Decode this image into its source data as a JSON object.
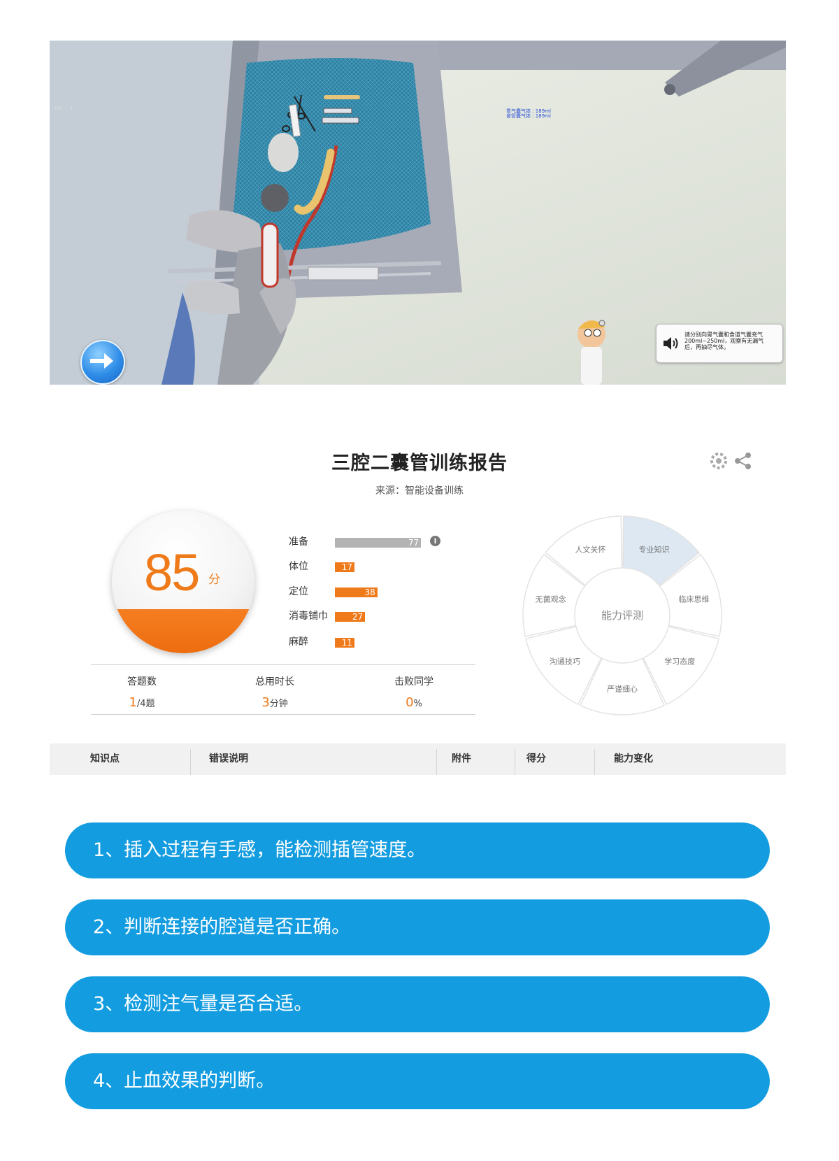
{
  "sim": {
    "fps_text": "FPS : 0",
    "hud_lines": [
      "胃气囊气体 : 189ml",
      "食管囊气体 : 189ml"
    ],
    "instruction": "请分别向胃气囊和食道气囊充气200ml~250ml，观察有无漏气后，再抽尽气体。"
  },
  "report": {
    "title": "三腔二囊管训练报告",
    "subtitle": "来源：智能设备训练",
    "score": "85",
    "score_unit": "分",
    "score_fill_fraction": 0.31,
    "categories": [
      {
        "label": "准备",
        "value": 77,
        "color": "#b3b3b3"
      },
      {
        "label": "体位",
        "value": 17,
        "color": "#ef7a1a"
      },
      {
        "label": "定位",
        "value": 38,
        "color": "#ef7a1a"
      },
      {
        "label": "消毒铺巾",
        "value": 27,
        "color": "#ef7a1a"
      },
      {
        "label": "麻醉",
        "value": 11,
        "color": "#ef7a1a"
      }
    ],
    "info_glyph": "i",
    "stats": {
      "answers_label": "答题数",
      "answers_done": "1",
      "answers_rest": "/4题",
      "time_label": "总用时长",
      "time_value": "3",
      "time_unit": "分钟",
      "beat_label": "击败同学",
      "beat_value": "0",
      "beat_unit": "%"
    },
    "radar": {
      "center": "能力评测",
      "segments": [
        "专业知识",
        "临床思维",
        "学习态度",
        "严谨细心",
        "沟通技巧",
        "无菌观念",
        "人文关怀"
      ],
      "highlighted": "专业知识",
      "highlight_color": "#dde8f3"
    },
    "table_headers": [
      "知识点",
      "错误说明",
      "附件",
      "得分",
      "能力变化"
    ]
  },
  "features": [
    "1、插入过程有手感，能检测插管速度。",
    "2、判断连接的腔道是否正确。",
    "3、检测注气量是否合适。",
    "4、止血效果的判断。"
  ]
}
